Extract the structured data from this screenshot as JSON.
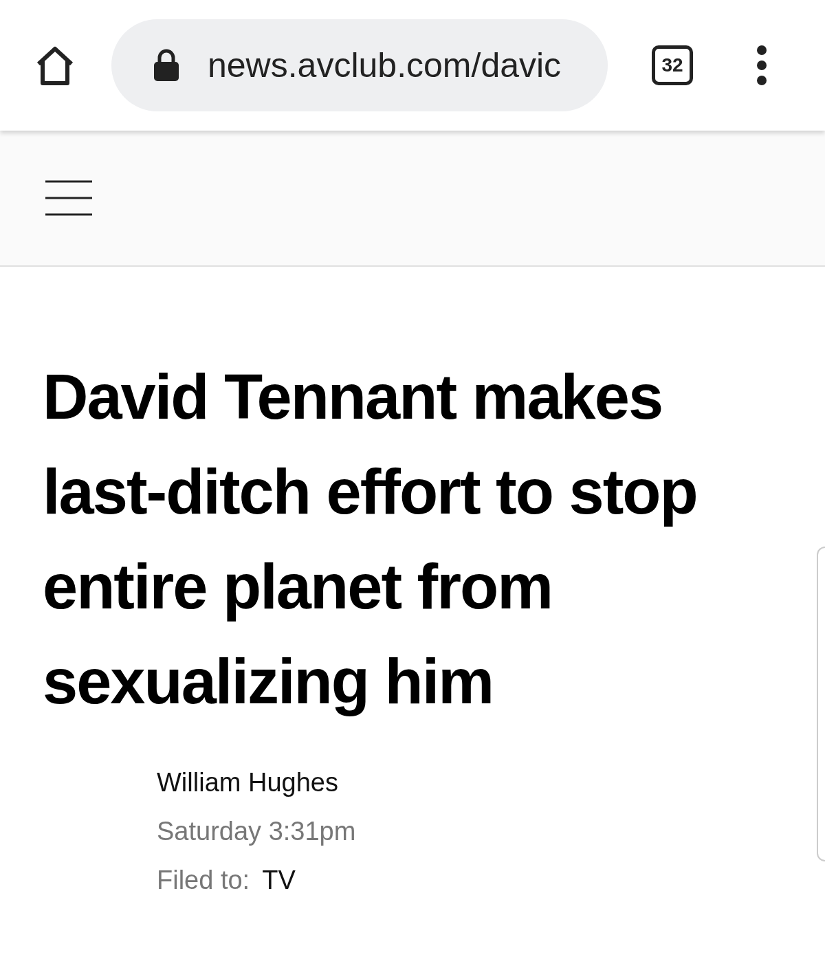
{
  "browser": {
    "url": "news.avclub.com/davic",
    "tab_count": "32"
  },
  "article": {
    "headline": "David Tennant makes last-ditch effort to stop entire planet from sexualizing him",
    "author": "William Hughes",
    "date": "Saturday 3:31pm",
    "filed_label": "Filed to:",
    "filed_value": "TV"
  }
}
